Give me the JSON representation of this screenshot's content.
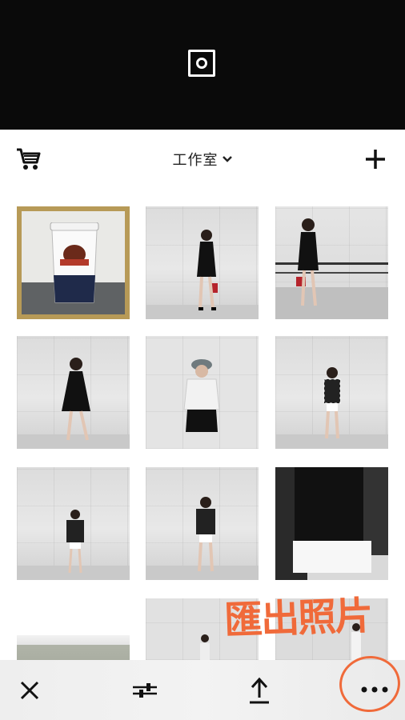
{
  "header": {
    "title": "工作室"
  },
  "annotation": {
    "text": "匯出照片"
  },
  "icons": {
    "camera": "camera-icon",
    "cart": "cart-icon",
    "chevron": "chevron-down-icon",
    "add": "plus-icon",
    "close": "close-icon",
    "adjust": "sliders-icon",
    "export": "upload-icon",
    "more": "more-icon"
  },
  "colors": {
    "selection": "#b79a57",
    "annotation": "#f06a3a"
  }
}
